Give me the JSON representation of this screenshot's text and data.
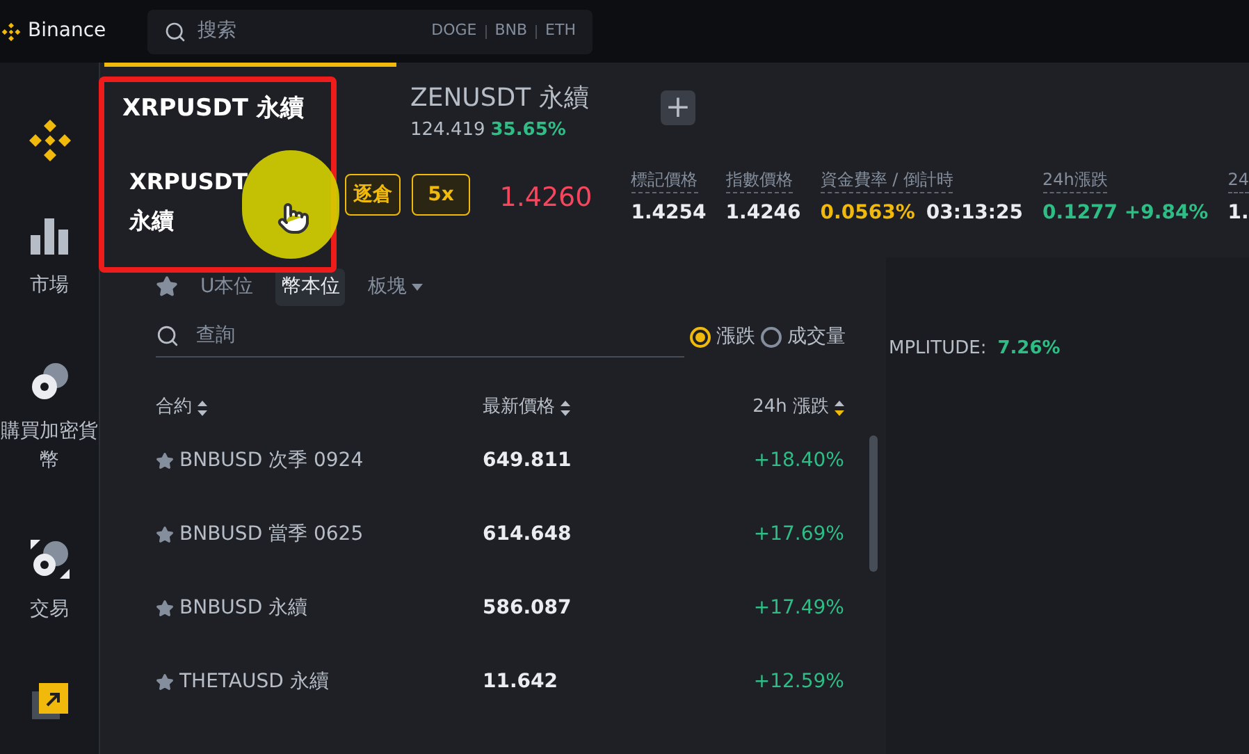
{
  "top_bar": {
    "brand": "Binance",
    "search": {
      "placeholder": "搜索",
      "suggestions": [
        "DOGE",
        "BNB",
        "ETH"
      ]
    }
  },
  "sidebar": {
    "items": [
      {
        "label": "市場"
      },
      {
        "label": "購買加密貨幣"
      },
      {
        "label": "交易"
      }
    ]
  },
  "tabs": [
    {
      "label": "XRPUSDT 永續",
      "selected": true
    },
    {
      "label": "ZENUSDT 永續",
      "price": "124.419",
      "change": "35.65%",
      "selected": false
    }
  ],
  "add_tab": "+",
  "drag_preview": {
    "label": "XRPUSDT 永續"
  },
  "order_controls": {
    "margin_mode": "逐倉",
    "leverage": "5x",
    "last_price": "1.4260"
  },
  "stats": [
    {
      "label": "標記價格",
      "values": [
        {
          "text": "1.4254",
          "color": "#eaecef"
        }
      ]
    },
    {
      "label": "指數價格",
      "values": [
        {
          "text": "1.4246",
          "color": "#eaecef"
        }
      ]
    },
    {
      "label": "資金費率 / 倒計時",
      "values": [
        {
          "text": "0.0563%",
          "color": "#f0b90b"
        },
        {
          "text": "03:13:25",
          "color": "#eaecef"
        }
      ]
    },
    {
      "label": "24h漲跌",
      "values": [
        {
          "text": "0.1277 +9.84%",
          "color": "#2ebd85"
        }
      ]
    },
    {
      "label": "24",
      "values": [
        {
          "text": "1.",
          "color": "#eaecef"
        }
      ]
    }
  ],
  "market_tabs": [
    {
      "label": "U本位",
      "selected": false,
      "dropdown": false
    },
    {
      "label": "幣本位",
      "selected": true,
      "dropdown": false
    },
    {
      "label": "板塊",
      "selected": false,
      "dropdown": true
    }
  ],
  "filter": {
    "placeholder": "查詢",
    "options": [
      {
        "label": "漲跌",
        "selected": true
      },
      {
        "label": "成交量",
        "selected": false
      }
    ]
  },
  "amplitude": {
    "label": "MPLITUDE:",
    "value": "7.26%"
  },
  "table": {
    "columns": [
      {
        "label": "合約",
        "sorted": false
      },
      {
        "label": "最新價格",
        "sorted": false
      },
      {
        "label": "24h 漲跌",
        "sorted": true
      }
    ],
    "rows": [
      {
        "symbol": "BNBUSD 次季 0924",
        "price": "649.811",
        "change": "+18.40%"
      },
      {
        "symbol": "BNBUSD 當季 0625",
        "price": "614.648",
        "change": "+17.69%"
      },
      {
        "symbol": "BNBUSD 永續",
        "price": "586.087",
        "change": "+17.49%"
      },
      {
        "symbol": "THETAUSD 永續",
        "price": "11.642",
        "change": "+12.59%"
      }
    ]
  }
}
